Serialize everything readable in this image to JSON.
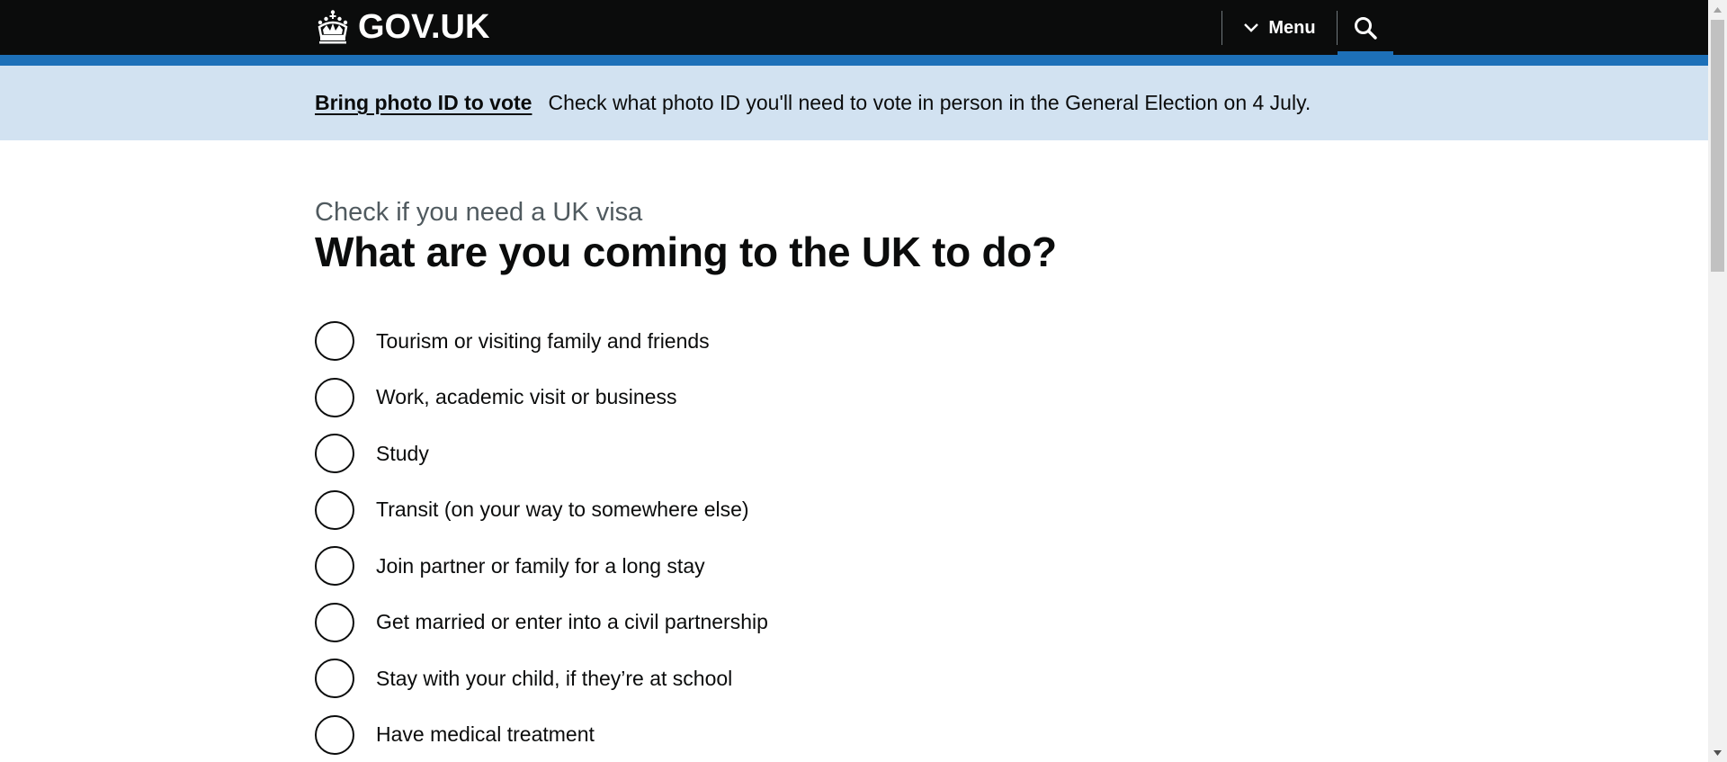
{
  "header": {
    "logo_text": "GOV.UK",
    "menu_label": "Menu",
    "search_label": "Search GOV.UK"
  },
  "banner": {
    "link_text": "Bring photo ID to vote",
    "message": "Check what photo ID you'll need to vote in person in the General Election on 4 July."
  },
  "question": {
    "caption": "Check if you need a UK visa",
    "heading": "What are you coming to the UK to do?"
  },
  "options": [
    {
      "label": "Tourism or visiting family and friends"
    },
    {
      "label": "Work, academic visit or business"
    },
    {
      "label": "Study"
    },
    {
      "label": "Transit (on your way to somewhere else)"
    },
    {
      "label": "Join partner or family for a long stay"
    },
    {
      "label": "Get married or enter into a civil partnership"
    },
    {
      "label": "Stay with your child, if they’re at school"
    },
    {
      "label": "Have medical treatment"
    }
  ],
  "colors": {
    "header_bg": "#0b0c0c",
    "brand_blue": "#1d70b8",
    "banner_bg": "#d2e2f1",
    "text": "#0b0c0c",
    "secondary_text": "#505a5f"
  },
  "icons": [
    "crown-icon",
    "chevron-down-icon",
    "search-icon"
  ]
}
